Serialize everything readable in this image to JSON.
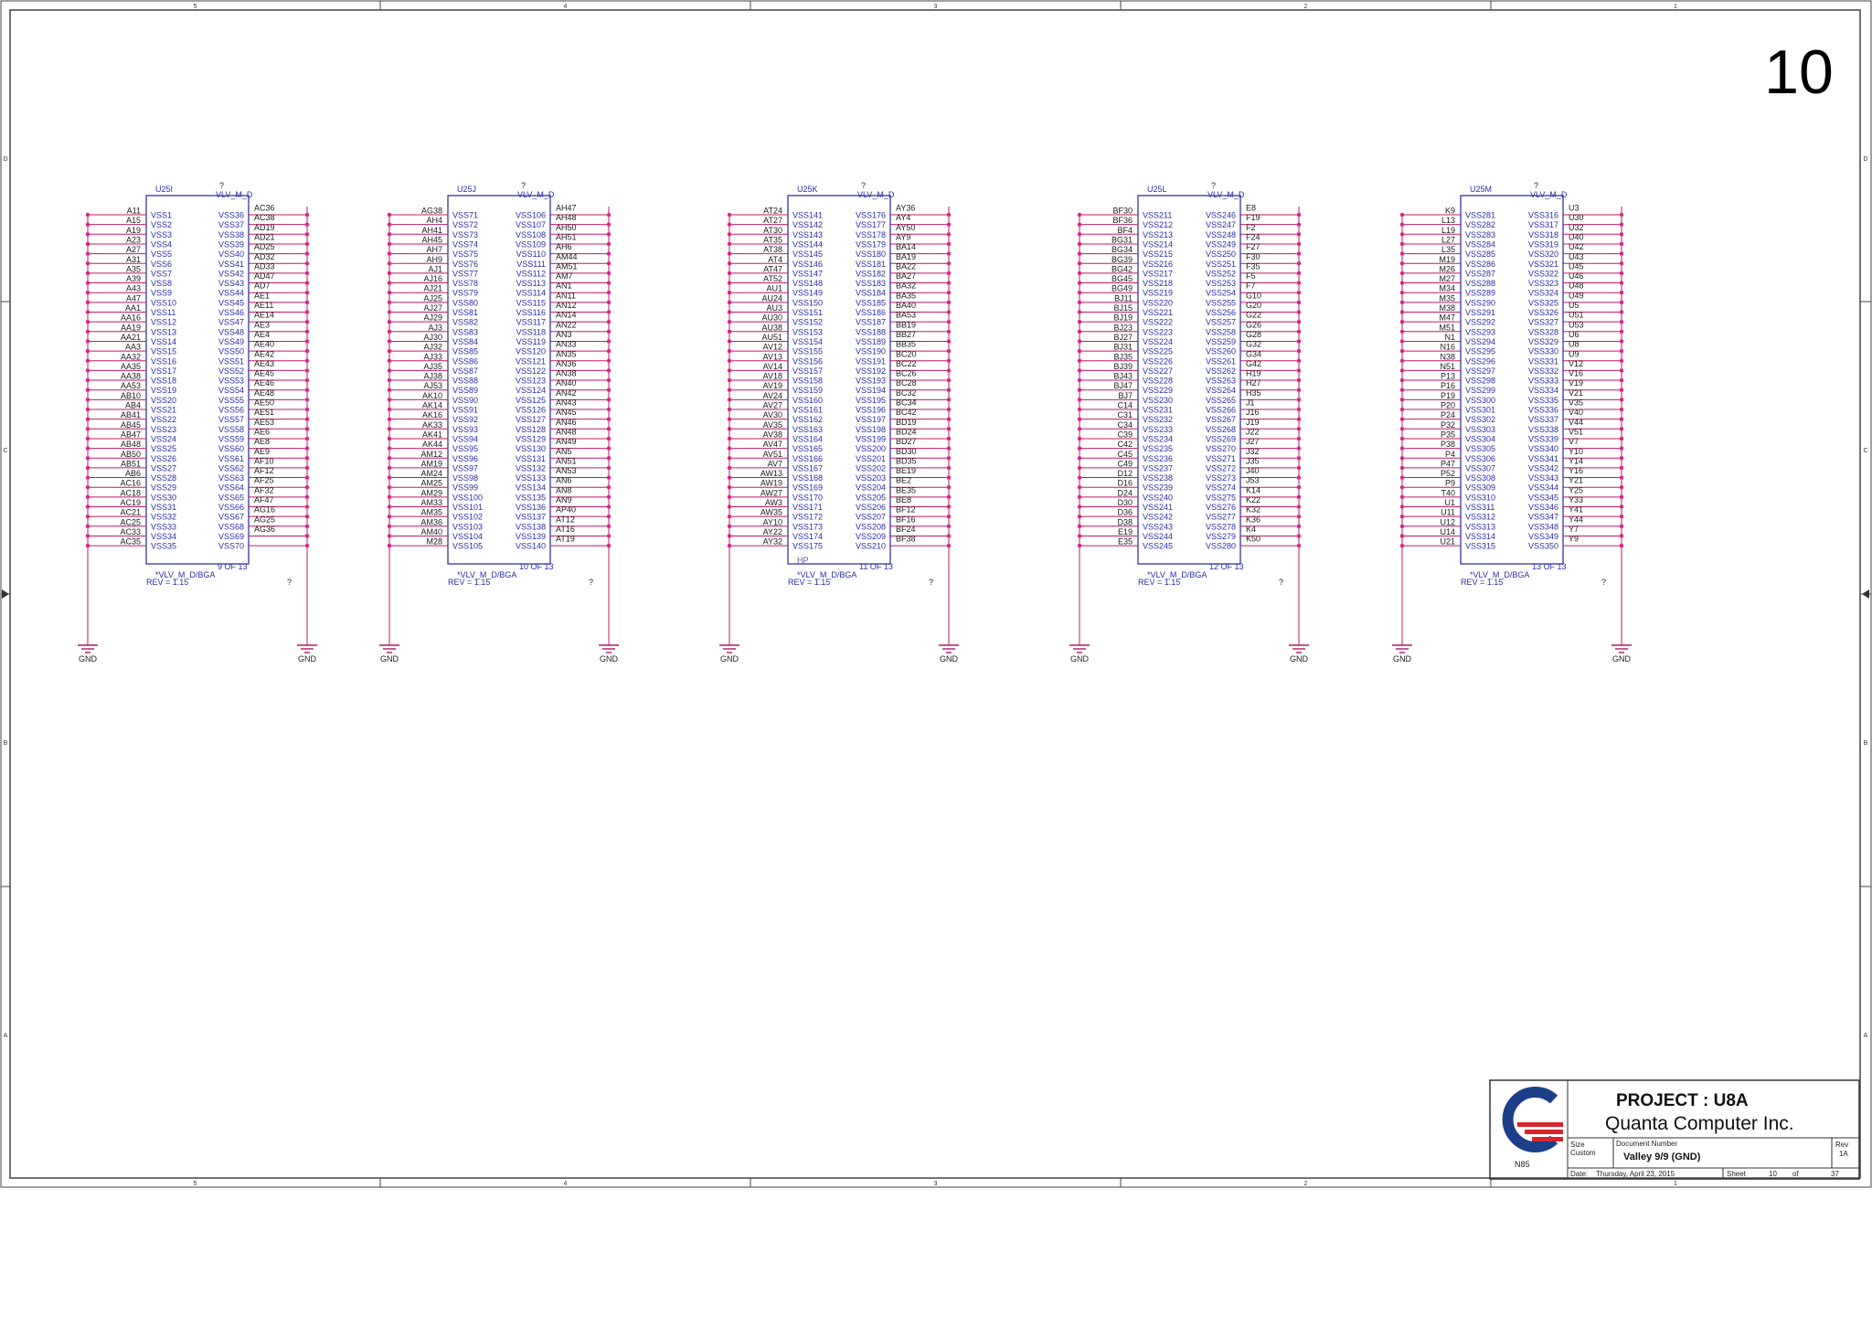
{
  "page_number": "10",
  "border": {
    "columns": [
      "5",
      "4",
      "3",
      "2",
      "1"
    ],
    "rows": [
      "D",
      "C",
      "B",
      "A"
    ]
  },
  "colors": {
    "frame": "#444444",
    "body": "#3434a6",
    "pin_text": "#2c2ca8",
    "wire": "#c2186a",
    "dot": "#e0208a",
    "ground": "#b0186a",
    "title_blue": "#1f27c8",
    "logo_blue": "#1d3f8a",
    "logo_red": "#d8262d"
  },
  "ground_label": "GND",
  "parts": [
    {
      "ref": "U25I",
      "value": "VLV_M_D",
      "flag": "?",
      "unit": "9 OF 13",
      "footprint": "*VLV_M_D/BGA",
      "rev": "REV = 1.15",
      "tag": "",
      "left_balls": [
        "A11",
        "A15",
        "A19",
        "A23",
        "A27",
        "A31",
        "A35",
        "A39",
        "A43",
        "A47",
        "AA1",
        "AA16",
        "AA19",
        "AA21",
        "AA3",
        "AA32",
        "AA35",
        "AA38",
        "AA53",
        "AB10",
        "AB4",
        "AB41",
        "AB45",
        "AB47",
        "AB48",
        "AB50",
        "AB51",
        "AB6",
        "AC16",
        "AC18",
        "AC19",
        "AC21",
        "AC25",
        "AC33",
        "AC35"
      ],
      "left_nets": [
        "VSS1",
        "VSS2",
        "VSS3",
        "VSS4",
        "VSS5",
        "VSS6",
        "VSS7",
        "VSS8",
        "VSS9",
        "VSS10",
        "VSS11",
        "VSS12",
        "VSS13",
        "VSS14",
        "VSS15",
        "VSS16",
        "VSS17",
        "VSS18",
        "VSS19",
        "VSS20",
        "VSS21",
        "VSS22",
        "VSS23",
        "VSS24",
        "VSS25",
        "VSS26",
        "VSS27",
        "VSS28",
        "VSS29",
        "VSS30",
        "VSS31",
        "VSS32",
        "VSS33",
        "VSS34",
        "VSS35"
      ],
      "right_nets": [
        "VSS36",
        "VSS37",
        "VSS38",
        "VSS39",
        "VSS40",
        "VSS41",
        "VSS42",
        "VSS43",
        "VSS44",
        "VSS45",
        "VSS46",
        "VSS47",
        "VSS48",
        "VSS49",
        "VSS50",
        "VSS51",
        "VSS52",
        "VSS53",
        "VSS54",
        "VSS55",
        "VSS56",
        "VSS57",
        "VSS58",
        "VSS59",
        "VSS60",
        "VSS61",
        "VSS62",
        "VSS63",
        "VSS64",
        "VSS65",
        "VSS66",
        "VSS67",
        "VSS68",
        "VSS69",
        "VSS70"
      ],
      "right_balls": [
        "AC36",
        "AC38",
        "AD19",
        "AD21",
        "AD25",
        "AD32",
        "AD33",
        "AD47",
        "AD7",
        "AE1",
        "AE11",
        "AE14",
        "AE3",
        "AE4",
        "AE40",
        "AE42",
        "AE43",
        "AE45",
        "AE46",
        "AE48",
        "AE50",
        "AE51",
        "AE53",
        "AE6",
        "AE8",
        "AE9",
        "AF10",
        "AF12",
        "AF25",
        "AF32",
        "AF47",
        "AG16",
        "AG25",
        "AG36"
      ]
    },
    {
      "ref": "U25J",
      "value": "VLV_M_D",
      "flag": "?",
      "unit": "10 OF 13",
      "footprint": "*VLV_M_D/BGA",
      "rev": "REV = 1.15",
      "tag": "",
      "left_balls": [
        "AG38",
        "AH4",
        "AH41",
        "AH45",
        "AH7",
        "AH9",
        "AJ1",
        "AJ16",
        "AJ21",
        "AJ25",
        "AJ27",
        "AJ29",
        "AJ3",
        "AJ30",
        "AJ32",
        "AJ33",
        "AJ35",
        "AJ38",
        "AJ53",
        "AK10",
        "AK14",
        "AK16",
        "AK33",
        "AK41",
        "AK44",
        "AM12",
        "AM19",
        "AM24",
        "AM25",
        "AM29",
        "AM33",
        "AM35",
        "AM36",
        "AM40",
        "M28"
      ],
      "left_nets": [
        "VSS71",
        "VSS72",
        "VSS73",
        "VSS74",
        "VSS75",
        "VSS76",
        "VSS77",
        "VSS78",
        "VSS79",
        "VSS80",
        "VSS81",
        "VSS82",
        "VSS83",
        "VSS84",
        "VSS85",
        "VSS86",
        "VSS87",
        "VSS88",
        "VSS89",
        "VSS90",
        "VSS91",
        "VSS92",
        "VSS93",
        "VSS94",
        "VSS95",
        "VSS96",
        "VSS97",
        "VSS98",
        "VSS99",
        "VSS100",
        "VSS101",
        "VSS102",
        "VSS103",
        "VSS104",
        "VSS105"
      ],
      "right_nets": [
        "VSS106",
        "VSS107",
        "VSS108",
        "VSS109",
        "VSS110",
        "VSS111",
        "VSS112",
        "VSS113",
        "VSS114",
        "VSS115",
        "VSS116",
        "VSS117",
        "VSS118",
        "VSS119",
        "VSS120",
        "VSS121",
        "VSS122",
        "VSS123",
        "VSS124",
        "VSS125",
        "VSS126",
        "VSS127",
        "VSS128",
        "VSS129",
        "VSS130",
        "VSS131",
        "VSS132",
        "VSS133",
        "VSS134",
        "VSS135",
        "VSS136",
        "VSS137",
        "VSS138",
        "VSS139",
        "VSS140"
      ],
      "right_balls": [
        "AH47",
        "AH48",
        "AH50",
        "AH51",
        "AH6",
        "AM44",
        "AM51",
        "AM7",
        "AN1",
        "AN11",
        "AN12",
        "AN14",
        "AN22",
        "AN3",
        "AN33",
        "AN35",
        "AN36",
        "AN38",
        "AN40",
        "AN42",
        "AN43",
        "AN45",
        "AN46",
        "AN48",
        "AN49",
        "AN5",
        "AN51",
        "AN53",
        "AN6",
        "AN8",
        "AN9",
        "AP40",
        "AT12",
        "AT16",
        "AT19"
      ]
    },
    {
      "ref": "U25K",
      "value": "VLV_M_D",
      "flag": "?",
      "unit": "11 OF 13",
      "footprint": "*VLV_M_D/BGA",
      "rev": "REV = 1.15",
      "tag": "HP",
      "left_balls": [
        "AT24",
        "AT27",
        "AT30",
        "AT35",
        "AT38",
        "AT4",
        "AT47",
        "AT52",
        "AU1",
        "AU24",
        "AU3",
        "AU30",
        "AU38",
        "AU51",
        "AV12",
        "AV13",
        "AV14",
        "AV18",
        "AV19",
        "AV24",
        "AV27",
        "AV30",
        "AV35",
        "AV38",
        "AV47",
        "AV51",
        "AV7",
        "AW13",
        "AW19",
        "AW27",
        "AW3",
        "AW35",
        "AY10",
        "AY22",
        "AY32"
      ],
      "left_nets": [
        "VSS141",
        "VSS142",
        "VSS143",
        "VSS144",
        "VSS145",
        "VSS146",
        "VSS147",
        "VSS148",
        "VSS149",
        "VSS150",
        "VSS151",
        "VSS152",
        "VSS153",
        "VSS154",
        "VSS155",
        "VSS156",
        "VSS157",
        "VSS158",
        "VSS159",
        "VSS160",
        "VSS161",
        "VSS162",
        "VSS163",
        "VSS164",
        "VSS165",
        "VSS166",
        "VSS167",
        "VSS168",
        "VSS169",
        "VSS170",
        "VSS171",
        "VSS172",
        "VSS173",
        "VSS174",
        "VSS175"
      ],
      "right_nets": [
        "VSS176",
        "VSS177",
        "VSS178",
        "VSS179",
        "VSS180",
        "VSS181",
        "VSS182",
        "VSS183",
        "VSS184",
        "VSS185",
        "VSS186",
        "VSS187",
        "VSS188",
        "VSS189",
        "VSS190",
        "VSS191",
        "VSS192",
        "VSS193",
        "VSS194",
        "VSS195",
        "VSS196",
        "VSS197",
        "VSS198",
        "VSS199",
        "VSS200",
        "VSS201",
        "VSS202",
        "VSS203",
        "VSS204",
        "VSS205",
        "VSS206",
        "VSS207",
        "VSS208",
        "VSS209",
        "VSS210"
      ],
      "right_balls": [
        "AY36",
        "AY4",
        "AY50",
        "AY9",
        "BA14",
        "BA19",
        "BA22",
        "BA27",
        "BA32",
        "BA35",
        "BA40",
        "BA53",
        "BB19",
        "BB27",
        "BB35",
        "BC20",
        "BC22",
        "BC26",
        "BC28",
        "BC32",
        "BC34",
        "BC42",
        "BD19",
        "BD24",
        "BD27",
        "BD30",
        "BD35",
        "BE19",
        "BE2",
        "BE35",
        "BE8",
        "BF12",
        "BF16",
        "BF24",
        "BF38"
      ]
    },
    {
      "ref": "U25L",
      "value": "VLV_M_D",
      "flag": "?",
      "unit": "12 OF 13",
      "footprint": "*VLV_M_D/BGA",
      "rev": "REV = 1.15",
      "tag": "",
      "left_balls": [
        "BF30",
        "BF36",
        "BF4",
        "BG31",
        "BG34",
        "BG39",
        "BG42",
        "BG45",
        "BG49",
        "BJ11",
        "BJ15",
        "BJ19",
        "BJ23",
        "BJ27",
        "BJ31",
        "BJ35",
        "BJ39",
        "BJ43",
        "BJ47",
        "BJ7",
        "C14",
        "C31",
        "C34",
        "C39",
        "C42",
        "C45",
        "C49",
        "D12",
        "D16",
        "D24",
        "D30",
        "D36",
        "D38",
        "E19",
        "E35"
      ],
      "left_nets": [
        "VSS211",
        "VSS212",
        "VSS213",
        "VSS214",
        "VSS215",
        "VSS216",
        "VSS217",
        "VSS218",
        "VSS219",
        "VSS220",
        "VSS221",
        "VSS222",
        "VSS223",
        "VSS224",
        "VSS225",
        "VSS226",
        "VSS227",
        "VSS228",
        "VSS229",
        "VSS230",
        "VSS231",
        "VSS232",
        "VSS233",
        "VSS234",
        "VSS235",
        "VSS236",
        "VSS237",
        "VSS238",
        "VSS239",
        "VSS240",
        "VSS241",
        "VSS242",
        "VSS243",
        "VSS244",
        "VSS245"
      ],
      "right_nets": [
        "VSS246",
        "VSS247",
        "VSS248",
        "VSS249",
        "VSS250",
        "VSS251",
        "VSS252",
        "VSS253",
        "VSS254",
        "VSS255",
        "VSS256",
        "VSS257",
        "VSS258",
        "VSS259",
        "VSS260",
        "VSS261",
        "VSS262",
        "VSS263",
        "VSS264",
        "VSS265",
        "VSS266",
        "VSS267",
        "VSS268",
        "VSS269",
        "VSS270",
        "VSS271",
        "VSS272",
        "VSS273",
        "VSS274",
        "VSS275",
        "VSS276",
        "VSS277",
        "VSS278",
        "VSS279",
        "VSS280"
      ],
      "right_balls": [
        "E8",
        "F19",
        "F2",
        "F24",
        "F27",
        "F30",
        "F35",
        "F5",
        "F7",
        "G10",
        "G20",
        "G22",
        "G26",
        "G28",
        "G32",
        "G34",
        "G42",
        "H19",
        "H27",
        "H35",
        "J1",
        "J16",
        "J19",
        "J22",
        "J27",
        "J32",
        "J35",
        "J40",
        "J53",
        "K14",
        "K22",
        "K32",
        "K36",
        "K4",
        "K50"
      ]
    },
    {
      "ref": "U25M",
      "value": "VLV_M_D",
      "flag": "?",
      "unit": "13 OF 13",
      "footprint": "*VLV_M_D/BGA",
      "rev": "REV = 1.15",
      "tag": "",
      "left_balls": [
        "K9",
        "L13",
        "L19",
        "L27",
        "L35",
        "M19",
        "M26",
        "M27",
        "M34",
        "M35",
        "M38",
        "M47",
        "M51",
        "N1",
        "N16",
        "N38",
        "N51",
        "P13",
        "P16",
        "P19",
        "P20",
        "P24",
        "P32",
        "P35",
        "P38",
        "P4",
        "P47",
        "P52",
        "P9",
        "T40",
        "U1",
        "U11",
        "U12",
        "U14",
        "U21"
      ],
      "left_nets": [
        "VSS281",
        "VSS282",
        "VSS283",
        "VSS284",
        "VSS285",
        "VSS286",
        "VSS287",
        "VSS288",
        "VSS289",
        "VSS290",
        "VSS291",
        "VSS292",
        "VSS293",
        "VSS294",
        "VSS295",
        "VSS296",
        "VSS297",
        "VSS298",
        "VSS299",
        "VSS300",
        "VSS301",
        "VSS302",
        "VSS303",
        "VSS304",
        "VSS305",
        "VSS306",
        "VSS307",
        "VSS308",
        "VSS309",
        "VSS310",
        "VSS311",
        "VSS312",
        "VSS313",
        "VSS314",
        "VSS315"
      ],
      "right_nets": [
        "VSS316",
        "VSS317",
        "VSS318",
        "VSS319",
        "VSS320",
        "VSS321",
        "VSS322",
        "VSS323",
        "VSS324",
        "VSS325",
        "VSS326",
        "VSS327",
        "VSS328",
        "VSS329",
        "VSS330",
        "VSS331",
        "VSS332",
        "VSS333",
        "VSS334",
        "VSS335",
        "VSS336",
        "VSS337",
        "VSS338",
        "VSS339",
        "VSS340",
        "VSS341",
        "VSS342",
        "VSS343",
        "VSS344",
        "VSS345",
        "VSS346",
        "VSS347",
        "VSS348",
        "VSS349",
        "VSS350"
      ],
      "right_balls": [
        "U3",
        "U30",
        "U32",
        "U40",
        "U42",
        "U43",
        "U45",
        "U46",
        "U48",
        "U49",
        "U5",
        "U51",
        "U53",
        "U6",
        "U8",
        "U9",
        "V12",
        "V16",
        "V19",
        "V21",
        "V35",
        "V40",
        "V44",
        "V51",
        "V7",
        "Y10",
        "Y14",
        "Y16",
        "Y21",
        "Y25",
        "Y33",
        "Y41",
        "Y44",
        "Y7",
        "Y9"
      ]
    }
  ],
  "title_block": {
    "project": "PROJECT : U8A",
    "company": "Quanta Computer Inc.",
    "logo_caption": "N85",
    "size_label": "Size",
    "size_value": "Custom",
    "doc_label": "Document Number",
    "doc_value": "Valley 9/9 (GND)",
    "rev_label": "Rev",
    "rev_value": "1A",
    "date_label": "Date:",
    "date_value": "Thursday, April 23, 2015",
    "sheet_label": "Sheet",
    "sheet_value": "10",
    "of_label": "of",
    "of_value": "37"
  }
}
